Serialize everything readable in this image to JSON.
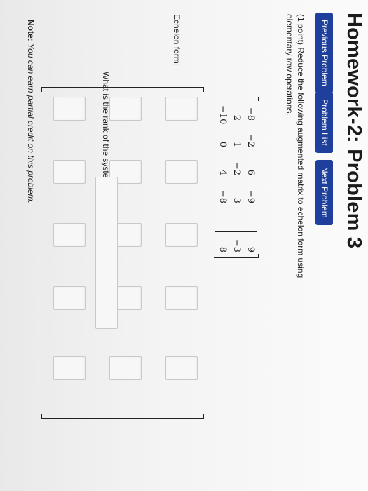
{
  "page": {
    "title": "Homework-2: Problem 3"
  },
  "nav": {
    "previous": "Previous Problem",
    "list": "Problem List",
    "next": "Next Problem"
  },
  "problem": {
    "points": "(1 point)",
    "text": "Reduce the following augmented matrix to echelon form using elementary row operations."
  },
  "matrix": {
    "rows": [
      [
        "−8",
        "−2",
        "6",
        "−9",
        "9"
      ],
      [
        "2",
        "1",
        "−2",
        "3",
        "−3"
      ],
      [
        "−10",
        "0",
        "4",
        "−8",
        "8"
      ]
    ]
  },
  "echelon": {
    "label": "Echelon form:"
  },
  "rank": {
    "question": "What is the rank of the system?"
  },
  "note": {
    "prefix": "Note:",
    "text": "You can earn partial credit on this problem."
  },
  "colors": {
    "button_bg": "#1e3f9c",
    "button_text": "#ffffff"
  }
}
